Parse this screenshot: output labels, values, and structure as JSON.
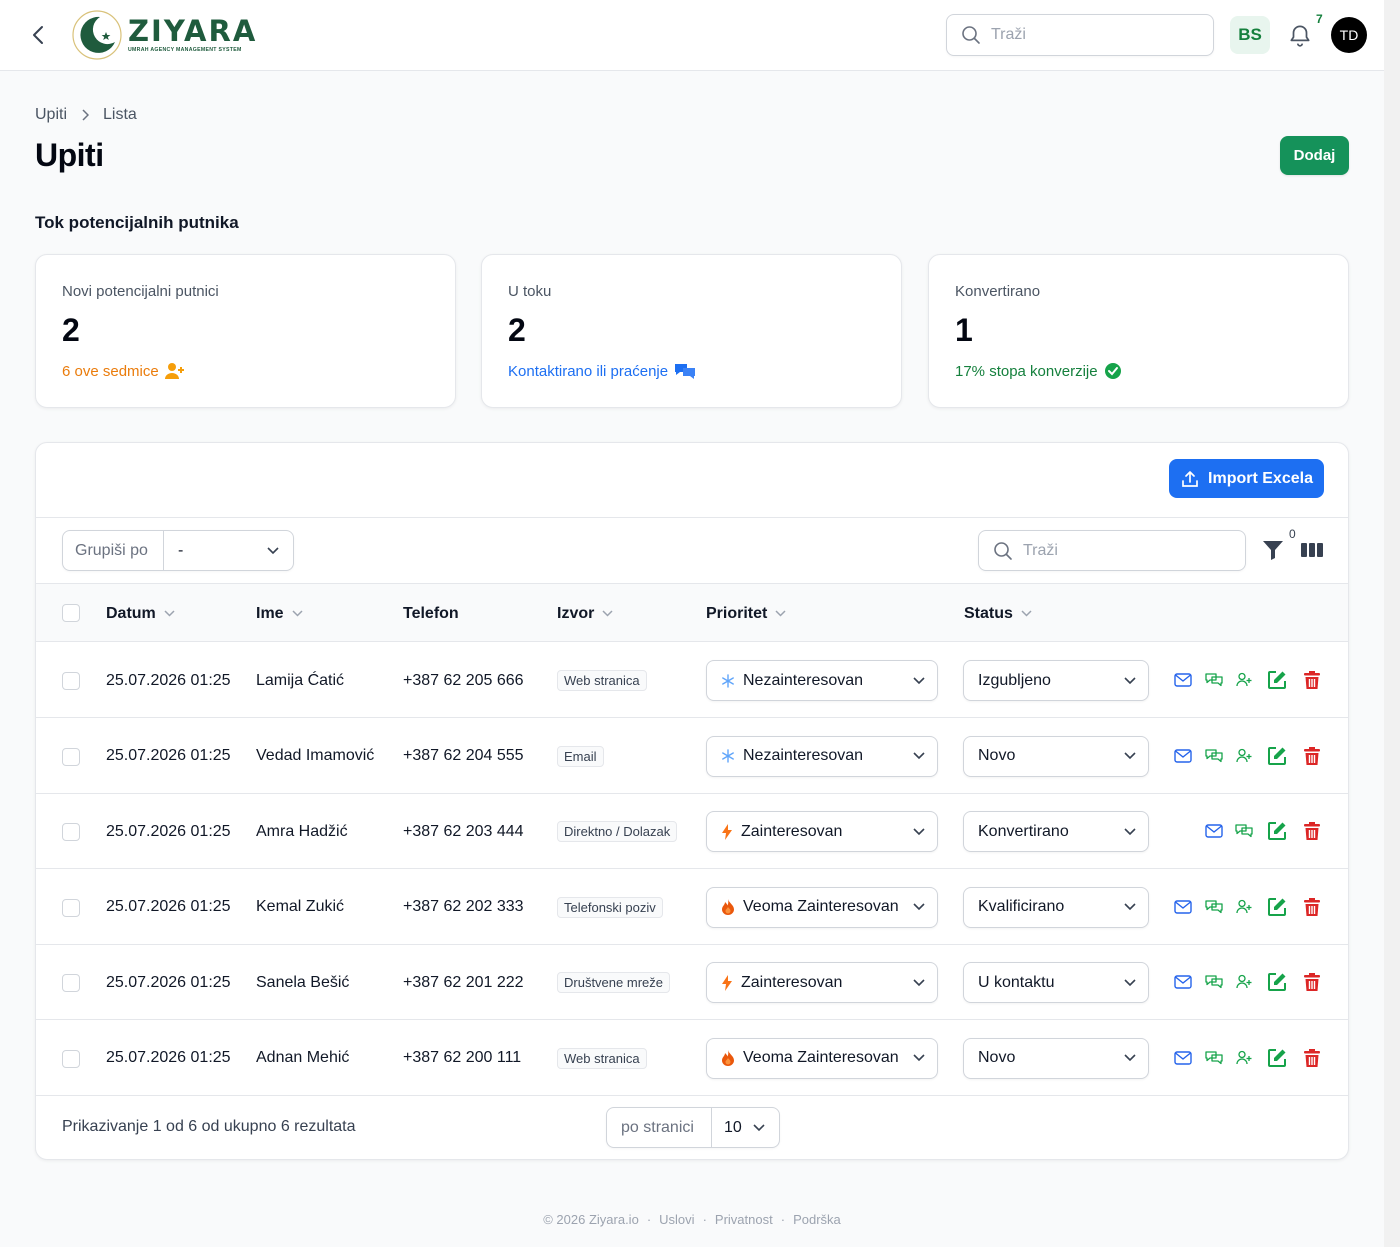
{
  "app": {
    "logo_text": "ZIYARA",
    "logo_subtitle": "UMRAH AGENCY MANAGEMENT SYSTEM",
    "search_placeholder": "Traži",
    "language": "BS",
    "notification_count": "7",
    "user_initials": "TD"
  },
  "breadcrumb": [
    "Upiti",
    "Lista"
  ],
  "page_title": "Upiti",
  "add_button": "Dodaj",
  "section_title": "Tok potencijalnih putnika",
  "stats": [
    {
      "label": "Novi potencijalni putnici",
      "value": "2",
      "desc": "6 ove sedmice",
      "color": "#ea7c0c",
      "icon": "user-plus-icon"
    },
    {
      "label": "U toku",
      "value": "2",
      "desc": "Kontaktirano ili praćenje",
      "color": "#1d6ff2",
      "icon": "chat-bubbles-icon"
    },
    {
      "label": "Konvertirano",
      "value": "1",
      "desc": "17% stopa konverzije",
      "color": "#15803d",
      "icon": "check-badge-icon"
    }
  ],
  "table": {
    "import_button": "Import Excela",
    "group_by_label": "Grupiši po",
    "group_by_value": "-",
    "search_placeholder": "Traži",
    "filter_count": "0",
    "columns": [
      "Datum",
      "Ime",
      "Telefon",
      "Izvor",
      "Prioritet",
      "Status"
    ],
    "rows": [
      {
        "date": "25.07.2026 01:25",
        "name": "Lamija Ćatić",
        "phone": "+387 62 205 666",
        "source": "Web stranica",
        "priority": "Nezainteresovan",
        "priority_icon": "snowflake-icon",
        "status": "Izgubljeno",
        "can_convert": true
      },
      {
        "date": "25.07.2026 01:25",
        "name": "Vedad Imamović",
        "phone": "+387 62 204 555",
        "source": "Email",
        "priority": "Nezainteresovan",
        "priority_icon": "snowflake-icon",
        "status": "Novo",
        "can_convert": true
      },
      {
        "date": "25.07.2026 01:25",
        "name": "Amra Hadžić",
        "phone": "+387 62 203 444",
        "source": "Direktno / Dolazak",
        "priority": "Zainteresovan",
        "priority_icon": "bolt-icon",
        "status": "Konvertirano",
        "can_convert": false
      },
      {
        "date": "25.07.2026 01:25",
        "name": "Kemal Zukić",
        "phone": "+387 62 202 333",
        "source": "Telefonski poziv",
        "priority": "Veoma Zainteresovan",
        "priority_icon": "fire-icon",
        "status": "Kvalificirano",
        "can_convert": true
      },
      {
        "date": "25.07.2026 01:25",
        "name": "Sanela Bešić",
        "phone": "+387 62 201 222",
        "source": "Društvene mreže",
        "priority": "Zainteresovan",
        "priority_icon": "bolt-icon",
        "status": "U kontaktu",
        "can_convert": true
      },
      {
        "date": "25.07.2026 01:25",
        "name": "Adnan Mehić",
        "phone": "+387 62 200 111",
        "source": "Web stranica",
        "priority": "Veoma Zainteresovan",
        "priority_icon": "fire-icon",
        "status": "Novo",
        "can_convert": true
      }
    ],
    "summary": "Prikazivanje 1 od 6 od ukupno 6 rezultata",
    "per_page_label": "po stranici",
    "per_page_value": "10"
  },
  "footer": [
    "© 2026 Ziyara.io",
    "Uslovi",
    "Privatnost",
    "Podrška"
  ],
  "colors": {
    "brand_green": "#15925a",
    "primary_blue": "#1d6ff2",
    "action_blue": "#1d6ff2",
    "action_green": "#15803d",
    "delete_red": "#dc2626"
  }
}
